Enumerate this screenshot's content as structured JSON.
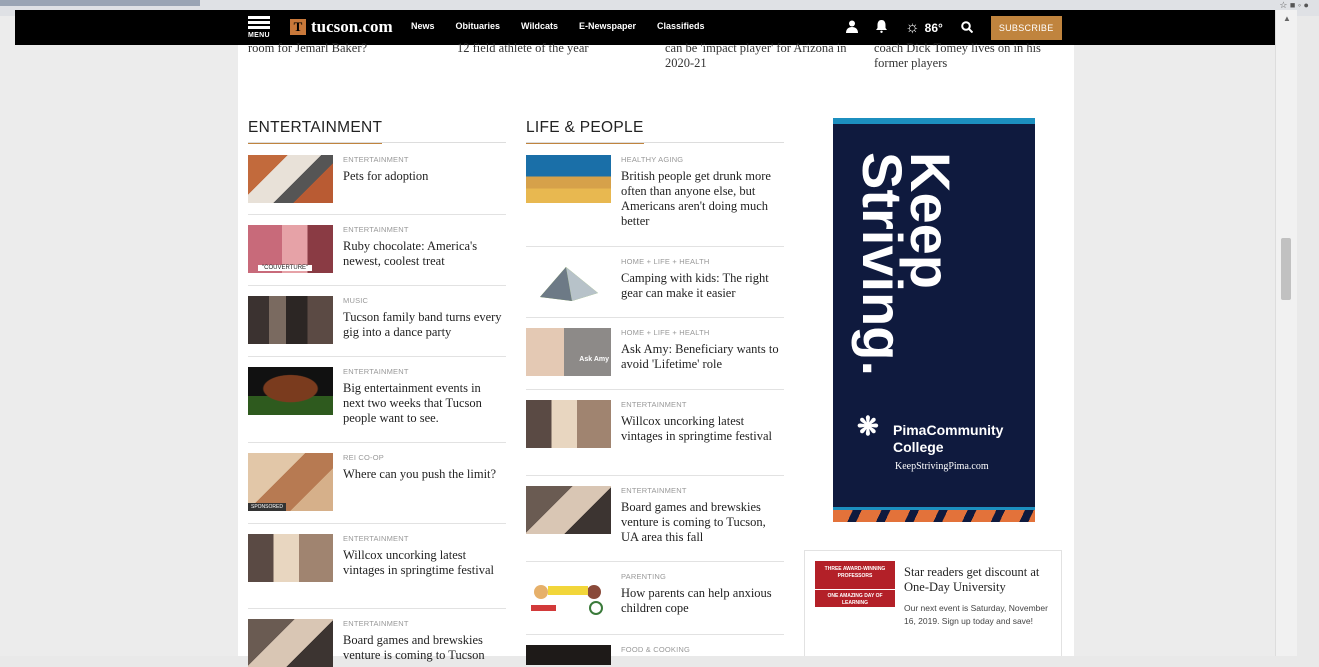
{
  "nav": {
    "menu_label": "MENU",
    "logo_mark": "T",
    "logo_text": "tucson.com",
    "links": [
      "News",
      "Obituaries",
      "Wildcats",
      "E-Newspaper",
      "Classifieds"
    ],
    "temperature": "86°",
    "subscribe_label": "SUBSCRIBE",
    "icons": [
      "user-icon",
      "bell-icon",
      "sun-icon",
      "search-icon"
    ]
  },
  "previous_row": [
    "room for Jemarl Baker?",
    "12 field athlete of the year",
    "can be 'impact player' for Arizona in 2020-21",
    "coach Dick Tomey lives on in his former players"
  ],
  "entertainment": {
    "heading": "ENTERTAINMENT",
    "items": [
      {
        "category": "ENTERTAINMENT",
        "title": "Pets for adoption"
      },
      {
        "category": "ENTERTAINMENT",
        "title": "Ruby chocolate: America's newest, coolest treat"
      },
      {
        "category": "MUSIC",
        "title": "Tucson family band turns every gig into a dance party"
      },
      {
        "category": "ENTERTAINMENT",
        "title": "Big entertainment events in next two weeks that Tucson people want to see."
      },
      {
        "category": "REI CO-OP",
        "title": "Where can you push the limit?"
      },
      {
        "category": "ENTERTAINMENT",
        "title": "Willcox uncorking latest vintages in springtime festival"
      },
      {
        "category": "ENTERTAINMENT",
        "title": "Board games and brewskies venture is coming to Tucson"
      }
    ],
    "sponsored_badge": "SPONSORED",
    "thumb_caption": "\"COUVERTURE\""
  },
  "life_people": {
    "heading": "LIFE & PEOPLE",
    "items": [
      {
        "category": "HEALTHY AGING",
        "title": "British people get drunk more often than anyone else, but Americans aren't doing much better"
      },
      {
        "category": "HOME + LIFE + HEALTH",
        "title": "Camping with kids: The right gear can make it easier"
      },
      {
        "category": "HOME + LIFE + HEALTH",
        "title": "Ask Amy: Beneficiary wants to avoid 'Lifetime' role"
      },
      {
        "category": "ENTERTAINMENT",
        "title": "Willcox uncorking latest vintages in springtime festival"
      },
      {
        "category": "ENTERTAINMENT",
        "title": "Board games and brewskies venture is coming to Tucson, UA area this fall"
      },
      {
        "category": "PARENTING",
        "title": "How parents can help anxious children cope"
      },
      {
        "category": "FOOD & COOKING",
        "title": ""
      }
    ],
    "ask_amy_label": "Ask Amy"
  },
  "ad": {
    "headline_1": "Keep",
    "headline_2": "Striving.",
    "college_name": "PimaCommunity College",
    "url": "KeepStrivingPima.com"
  },
  "promo": {
    "image_text_1": "THREE AWARD-WINNING PROFESSORS",
    "image_text_2": "ONE AMAZING DAY OF LEARNING",
    "title": "Star readers get discount at One-Day University",
    "description": "Our next event is Saturday, November 16, 2019. Sign up today and save!"
  }
}
